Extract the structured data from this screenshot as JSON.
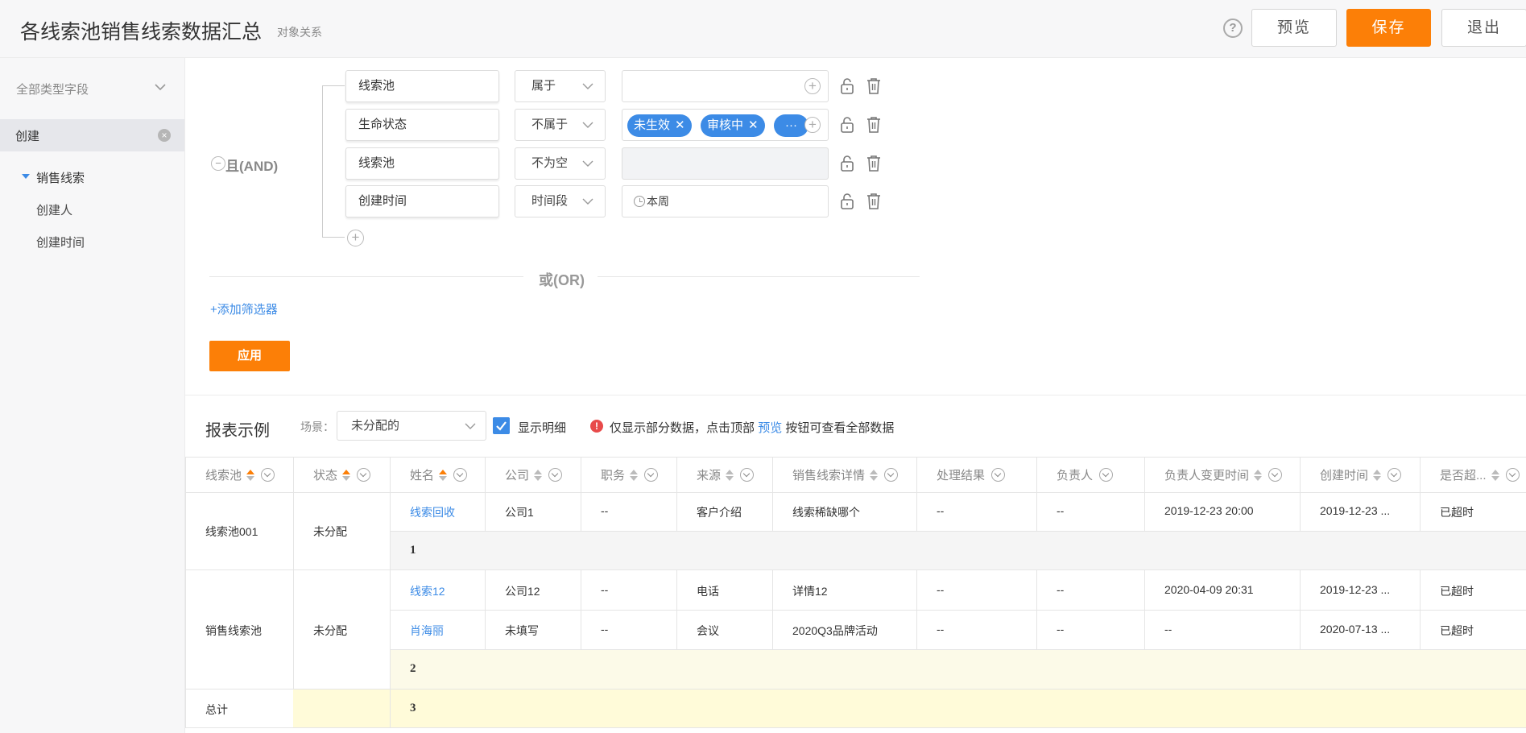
{
  "header": {
    "title": "各线索池销售线索数据汇总",
    "subtitle": "对象关系",
    "help_icon": "?",
    "preview_label": "预览",
    "save_label": "保存",
    "exit_label": "退出"
  },
  "sidebar": {
    "filter_label": "全部类型字段",
    "selected_label": "创建",
    "tree_root": "销售线索",
    "tree_children": [
      "创建人",
      "创建时间"
    ]
  },
  "filter": {
    "group_logic": "且(AND)",
    "conditions": [
      {
        "field": "线索池",
        "operator": "属于",
        "value_type": "empty"
      },
      {
        "field": "生命状态",
        "operator": "不属于",
        "value_type": "tags",
        "tags": [
          "未生效",
          "审核中"
        ],
        "more": "···"
      },
      {
        "field": "线索池",
        "operator": "不为空",
        "value_type": "disabled"
      },
      {
        "field": "创建时间",
        "operator": "时间段",
        "value_type": "date",
        "value": "本周"
      }
    ],
    "or_label": "或(OR)",
    "add_filter_label": "+添加筛选器",
    "apply_label": "应用"
  },
  "report": {
    "title": "报表示例",
    "scene_label": "场景：",
    "scene_value": "未分配的",
    "show_detail_label": "显示明细",
    "show_detail_checked": true,
    "notice_prefix": "仅显示部分数据，点击顶部",
    "notice_link": "预览",
    "notice_suffix": "按钮可查看全部数据"
  },
  "table": {
    "columns": [
      "线索池",
      "状态",
      "姓名",
      "公司",
      "职务",
      "来源",
      "销售线索详情",
      "处理结果",
      "负责人",
      "负责人变更时间",
      "创建时间",
      "是否超..."
    ],
    "groups": [
      {
        "pool": "线索池001",
        "status": "未分配",
        "rows": [
          [
            "线索回收",
            "公司1",
            "--",
            "客户介绍",
            "线索稀缺哪个",
            "--",
            "--",
            "2019-12-23 20:00",
            "2019-12-23 ...",
            "已超时"
          ]
        ],
        "subtotal": "1"
      },
      {
        "pool": "销售线索池",
        "status": "未分配",
        "rows": [
          [
            "线索12",
            "公司12",
            "--",
            "电话",
            "详情12",
            "--",
            "--",
            "2020-04-09 20:31",
            "2019-12-23 ...",
            "已超时"
          ],
          [
            "肖海丽",
            "未填写",
            "--",
            "会议",
            "2020Q3品牌活动",
            "--",
            "--",
            "--",
            "2020-07-13 ...",
            "已超时"
          ]
        ],
        "subtotal": "2"
      }
    ],
    "total_label": "总计",
    "total_value": "3"
  },
  "colors": {
    "accent": "#fc7f07",
    "link": "#3c8be6",
    "subtotal_yellow": "#fcfae8",
    "total_yellow": "#fffbd9"
  }
}
